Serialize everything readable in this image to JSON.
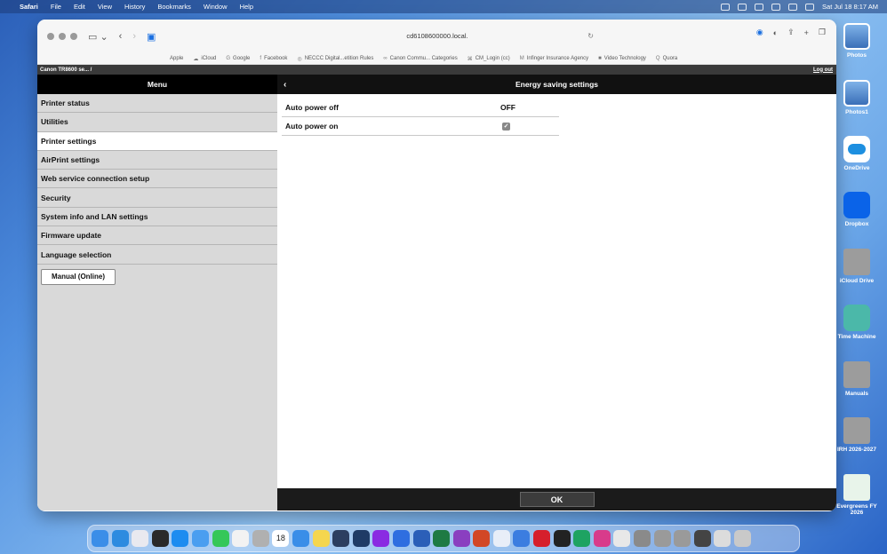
{
  "menubar": {
    "items": [
      "Safari",
      "File",
      "Edit",
      "View",
      "History",
      "Bookmarks",
      "Window",
      "Help"
    ],
    "datetime": "Sat Jul 18  8:17 AM"
  },
  "browser": {
    "url": "cd6108600000.local.",
    "favorites": [
      "Apple",
      "iCloud",
      "Google",
      "Facebook",
      "NECCC Digital...etition Rules",
      "Canon Commu... Categories",
      "CM_Login (cc)",
      "Infinger Insurance Agency",
      "Video Technology",
      "Quora"
    ]
  },
  "page": {
    "breadcrumb": "Canon TR8600 se... /",
    "logout_label": "Log out",
    "menu_title": "Menu",
    "menu_items": [
      "Printer status",
      "Utilities",
      "Printer settings",
      "AirPrint settings",
      "Web service connection setup",
      "Security",
      "System info and LAN settings",
      "Firmware update",
      "Language selection"
    ],
    "active_menu_item": "Printer settings",
    "manual_button": "Manual (Online)",
    "panel_title": "Energy saving settings",
    "settings": [
      {
        "label": "Auto power off",
        "value": "OFF"
      },
      {
        "label": "Auto power on",
        "value": "",
        "checked": true
      }
    ],
    "ok_button": "OK"
  },
  "desktop_icons": [
    "Photos",
    "Photos1",
    "OneDrive",
    "Dropbox",
    "iCloud Drive",
    "Time Machine",
    "Manuals",
    "IRH 2026-2027",
    "Evergreens FY 2026"
  ],
  "dock": {
    "calendar_day": "18"
  }
}
